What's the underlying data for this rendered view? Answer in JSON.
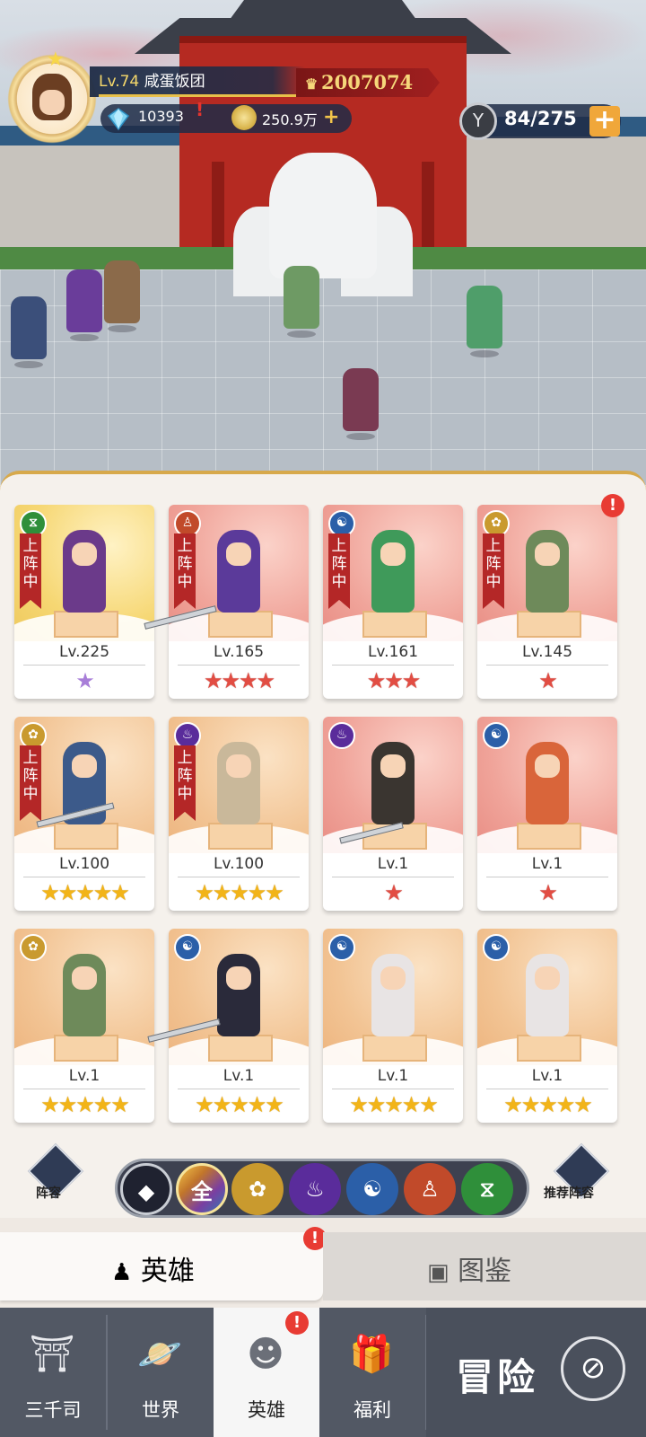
{
  "hud": {
    "player_level": "Lv.74",
    "player_name": "咸蛋饭团",
    "power": "2007074",
    "diamonds": "10393",
    "gold": "250.9万",
    "stamina": "84/275",
    "alert_mark": "!"
  },
  "heroes": [
    {
      "level": "Lv.225",
      "status": "上阵中",
      "faction_icon": "dna-icon",
      "faction_color": "#2f8f3a",
      "stars_text": "★",
      "star_type": "purple"
    },
    {
      "level": "Lv.165",
      "status": "上阵中",
      "faction_icon": "meditation-icon",
      "faction_color": "#c14a2a",
      "stars_text": "★★★★",
      "star_type": "red"
    },
    {
      "level": "Lv.161",
      "status": "上阵中",
      "faction_icon": "yinyang-icon",
      "faction_color": "#2b5fa8",
      "stars_text": "★★★",
      "star_type": "red"
    },
    {
      "level": "Lv.145",
      "status": "上阵中",
      "faction_icon": "lotus-icon",
      "faction_color": "#c99a2e",
      "stars_text": "★",
      "star_type": "red"
    },
    {
      "level": "Lv.100",
      "status": "上阵中",
      "faction_icon": "lotus-icon",
      "faction_color": "#c99a2e",
      "stars_text": "★★★★★",
      "star_type": "gold"
    },
    {
      "level": "Lv.100",
      "status": "上阵中",
      "faction_icon": "flame-icon",
      "faction_color": "#5a2c9b",
      "stars_text": "★★★★★",
      "star_type": "gold"
    },
    {
      "level": "Lv.1",
      "status": "",
      "faction_icon": "flame-icon",
      "faction_color": "#5a2c9b",
      "stars_text": "★",
      "star_type": "red"
    },
    {
      "level": "Lv.1",
      "status": "",
      "faction_icon": "yinyang-icon",
      "faction_color": "#2b5fa8",
      "stars_text": "★",
      "star_type": "red"
    },
    {
      "level": "Lv.1",
      "status": "",
      "faction_icon": "lotus-icon",
      "faction_color": "#c99a2e",
      "stars_text": "★★★★★",
      "star_type": "gold"
    },
    {
      "level": "Lv.1",
      "status": "",
      "faction_icon": "yinyang-icon",
      "faction_color": "#2b5fa8",
      "stars_text": "★★★★★",
      "star_type": "gold"
    },
    {
      "level": "Lv.1",
      "status": "",
      "faction_icon": "yinyang-icon",
      "faction_color": "#2b5fa8",
      "stars_text": "★★★★★",
      "star_type": "gold"
    },
    {
      "level": "Lv.1",
      "status": "",
      "faction_icon": "yinyang-icon",
      "faction_color": "#2b5fa8",
      "stars_text": "★★★★★",
      "star_type": "gold"
    }
  ],
  "filters": {
    "lineup_label": "阵容",
    "recommend_label": "推荐阵容",
    "all_label": "全",
    "options": [
      "diamond-icon",
      "all",
      "lotus-icon",
      "flame-icon",
      "yinyang-icon",
      "meditation-icon",
      "dna-icon"
    ]
  },
  "tabs": {
    "heroes_label": "英雄",
    "codex_label": "图鉴"
  },
  "nav": {
    "items": [
      {
        "label": "三千司",
        "icon": "temple-icon"
      },
      {
        "label": "世界",
        "icon": "planet-icon"
      },
      {
        "label": "英雄",
        "icon": "hero-head-icon"
      },
      {
        "label": "福利",
        "icon": "gift-box-icon"
      }
    ],
    "adventure_label": "冒险",
    "adventure_icon": "compass-icon"
  }
}
